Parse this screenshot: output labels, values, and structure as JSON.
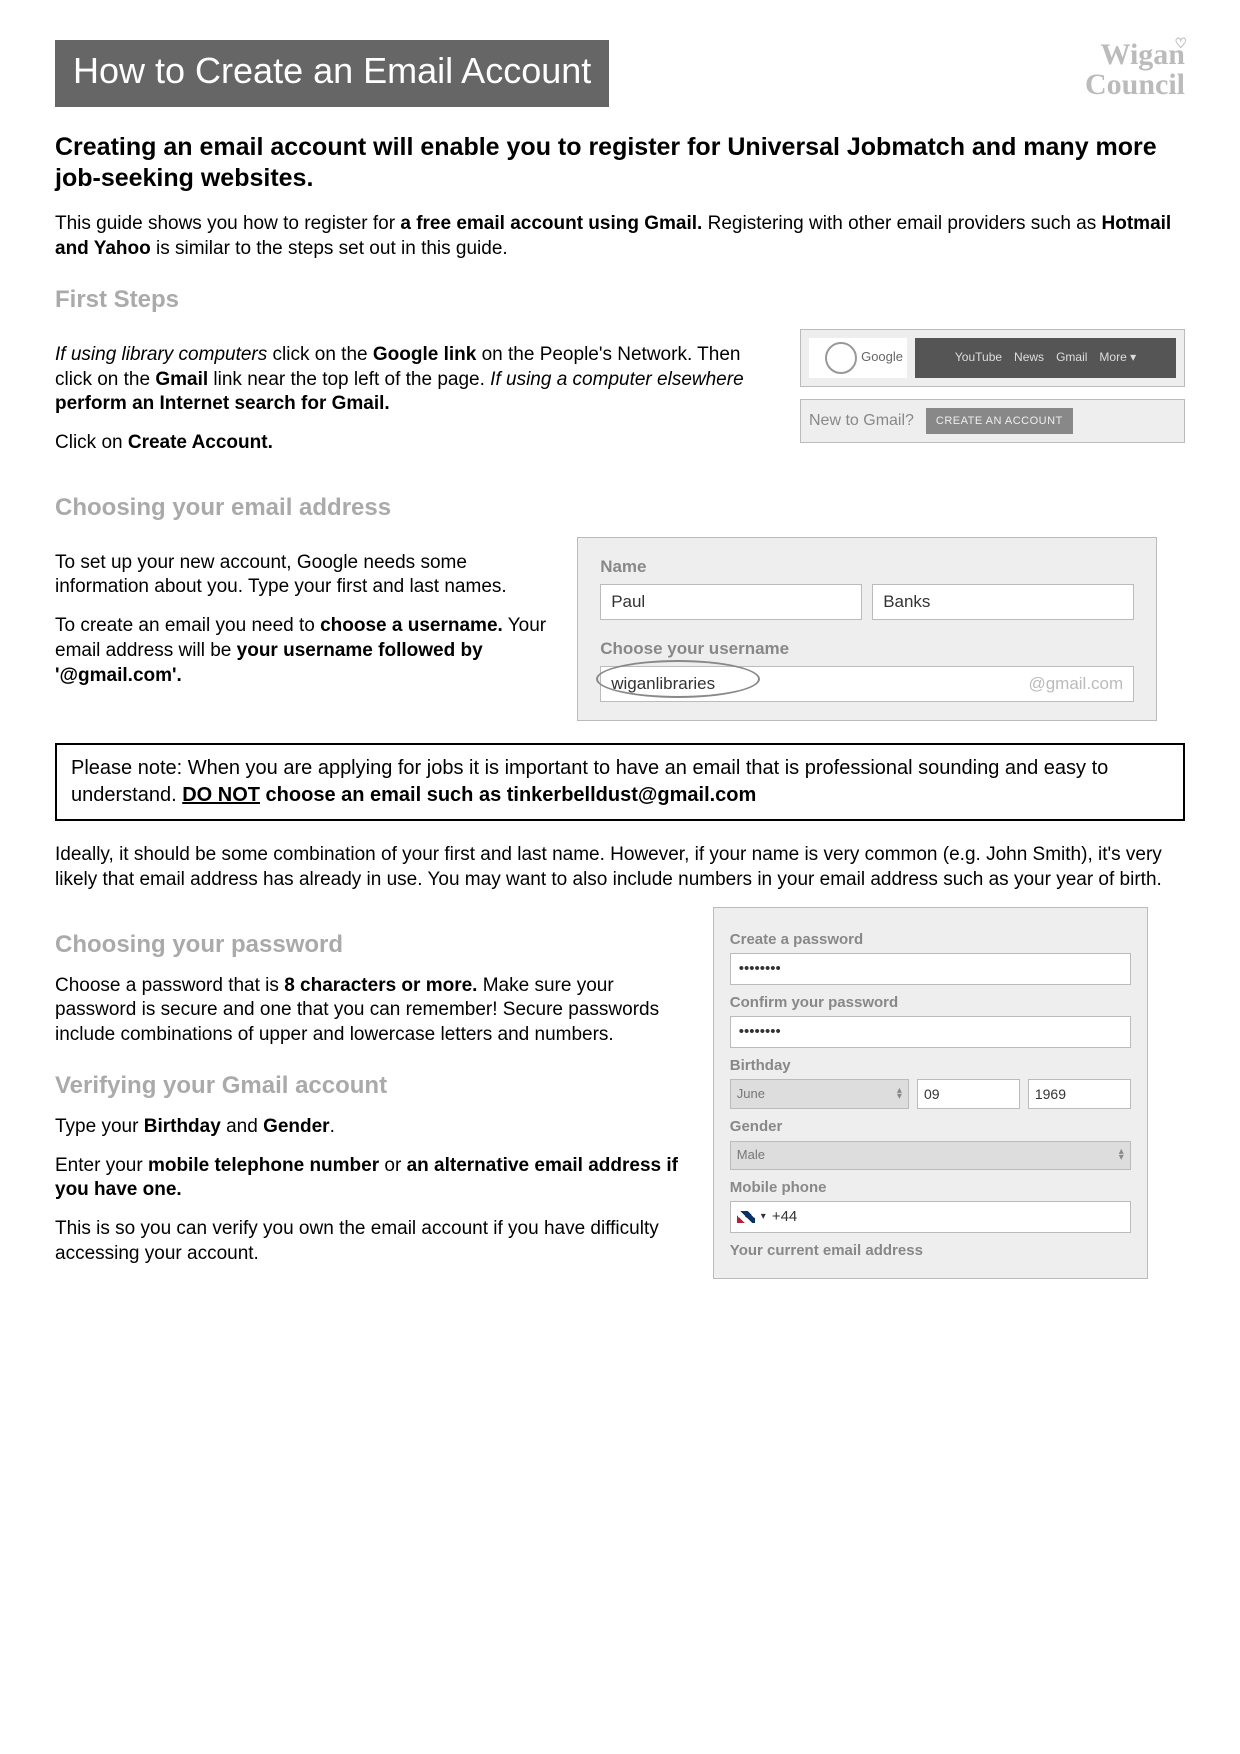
{
  "banner": "How to Create an Email Account",
  "logo_line1": "Wigan",
  "logo_line2": "Council",
  "intro_heading": "Creating an email account will enable you to register for Universal Jobmatch and many more job-seeking websites.",
  "intro_p1_a": "This guide shows you how to register for ",
  "intro_p1_b": "a free email account using Gmail.",
  "intro_p1_c": " Registering with other email providers such as ",
  "intro_p1_d": "Hotmail and Yahoo",
  "intro_p1_e": " is similar to  the steps set out in this guide.",
  "sec1": "First Steps",
  "s1p1_a": "If using library computers",
  "s1p1_b": " click on the ",
  "s1p1_c": "Google link",
  "s1p1_d": " on the People's Network. Then click on the ",
  "s1p1_e": "Gmail",
  "s1p1_f": " link near the top left of the page. ",
  "s1p1_g": "If using a computer elsewhere ",
  "s1p1_h": "perform an Internet search for Gmail.",
  "s1p2_a": "Click on ",
  "s1p2_b": "Create Account.",
  "g_label": "Google",
  "g_youtube": "YouTube",
  "g_news": "News",
  "g_gmail": "Gmail",
  "g_more": "More ▾",
  "new_to": "New to Gmail?",
  "create_btn": "CREATE AN ACCOUNT",
  "sec2": "Choosing your email address",
  "s2p1": "To set up your new account, Google needs some information about you. Type your first and last names.",
  "s2p2_a": "To create an email you need to ",
  "s2p2_b": "choose a username.",
  "s2p2_c": " Your email address will be ",
  "s2p2_d": "your username followed by '@gmail.com'.",
  "form_name_lbl": "Name",
  "form_first": "Paul",
  "form_last": "Banks",
  "form_user_lbl": "Choose your username",
  "form_user": "wiganlibraries",
  "form_suffix": "@gmail.com",
  "note_a": "Please note: When you are applying for jobs it is important to have an email that is professional sounding and easy to understand. ",
  "note_b": "DO NOT",
  "note_c": " choose an email such as tinkerbelldust@gmail.com",
  "after_note": "Ideally, it should be some combination of your first and last name. However, if your name is very common (e.g. John Smith), it's very likely that email address has already in use. You may want to also include numbers in your email address such as your year of birth.",
  "sec3": "Choosing your password",
  "s3p1_a": "Choose a password that is ",
  "s3p1_b": "8 characters or more.",
  "s3p1_c": " Make sure your password is  secure and one that you can remember!   Secure passwords include combinations of upper and lowercase letters and numbers.",
  "sec4": "Verifying your Gmail account",
  "s4p1_a": "Type your ",
  "s4p1_b": "Birthday",
  "s4p1_c": " and ",
  "s4p1_d": "Gender",
  "s4p1_e": ".",
  "s4p2_a": "Enter your ",
  "s4p2_b": "mobile telephone number",
  "s4p2_c": " or ",
  "s4p2_d": "an alternative email address if you have one.",
  "s4p3": "This is so you can verify you own the email account if you have difficulty accessing your account.",
  "pw_create": "Create a password",
  "pw_dots": "••••••••",
  "pw_confirm": "Confirm your password",
  "pw_birthday": "Birthday",
  "pw_month": "June",
  "pw_day": "09",
  "pw_year": "1969",
  "pw_gender_lbl": "Gender",
  "pw_gender": "Male",
  "pw_mobile_lbl": "Mobile phone",
  "pw_cc": "+44",
  "pw_current": "Your current email address"
}
